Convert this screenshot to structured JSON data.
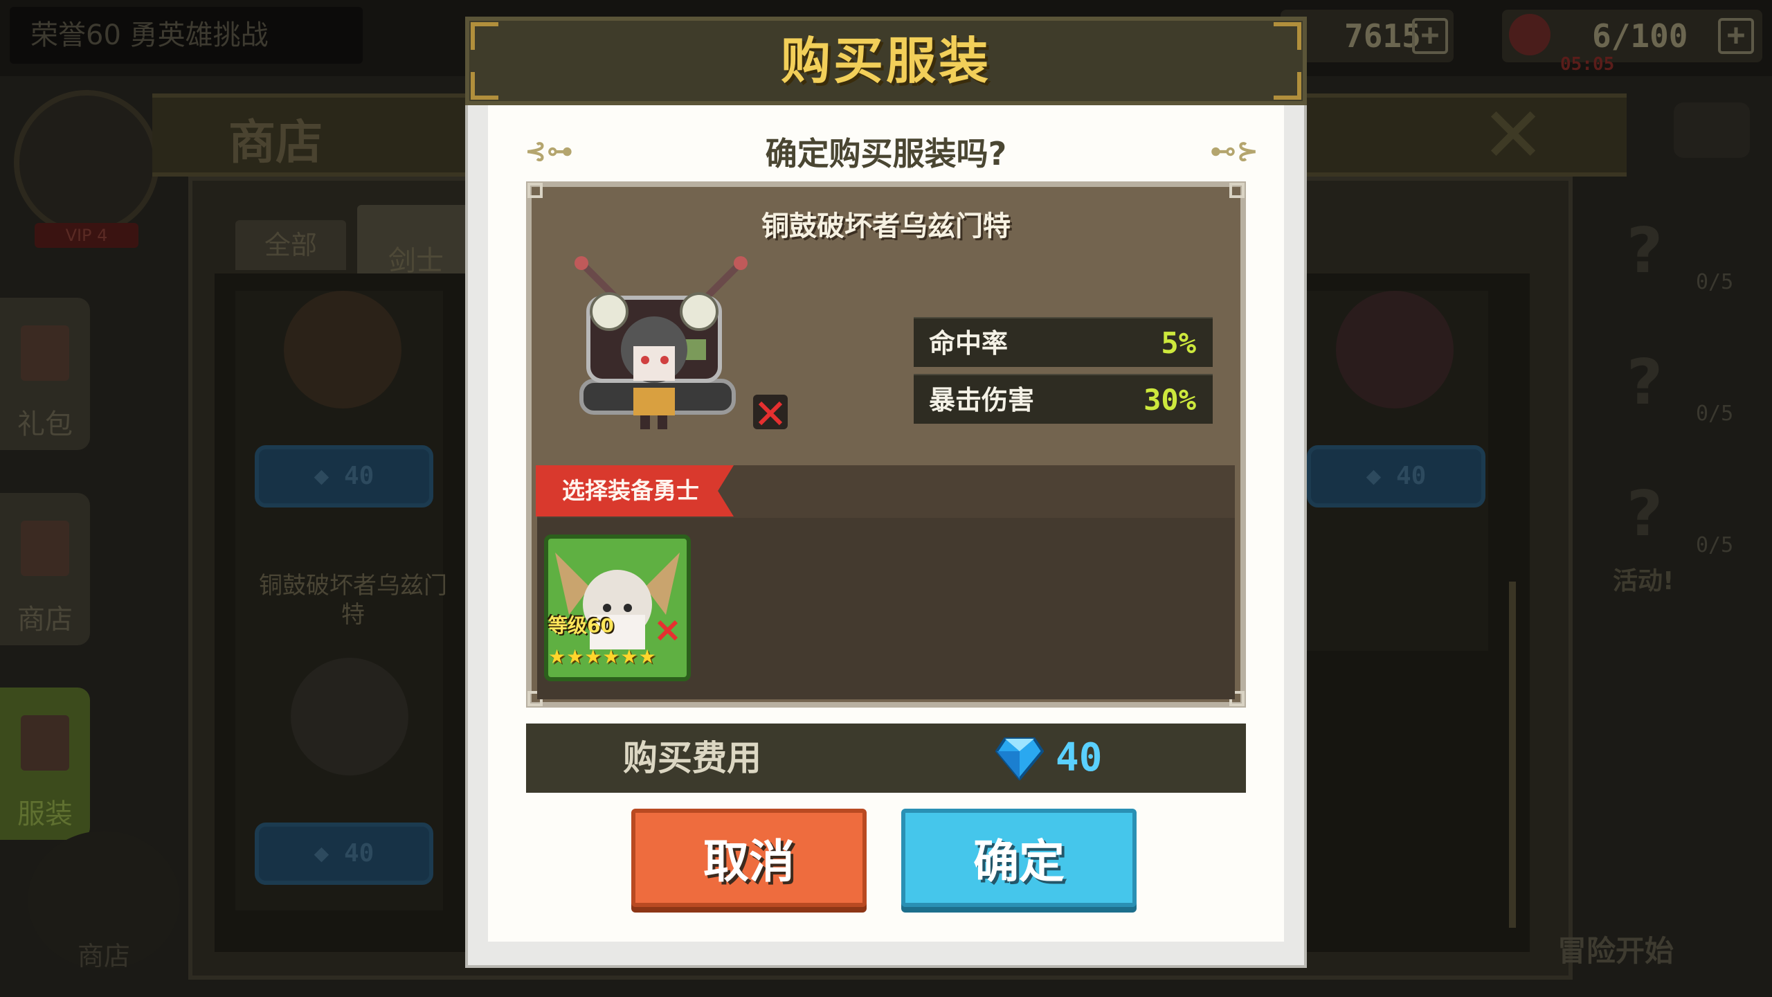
{
  "background": {
    "top_message": "荣誉60 勇英雄挑战",
    "gold": "7615",
    "stamina": "6/100",
    "stamina_timer": "05:05",
    "shop_title": "商店",
    "vip_label": "VIP 4",
    "side_tabs": [
      "礼包",
      "商店",
      "服装"
    ],
    "bottom_shop": "商店",
    "categories": [
      "全部",
      "剑士"
    ],
    "item_name_bg": "铜鼓破坏者乌兹门特",
    "gem_prices": [
      "40",
      "40",
      "40"
    ],
    "right_counts": [
      "0/5",
      "0/5",
      "0/5"
    ],
    "right_event": "活动!",
    "adventure_start": "冒险开始"
  },
  "modal": {
    "title": "购买服装",
    "question": "确定购买服装吗?",
    "item_name": "铜鼓破坏者乌兹门特",
    "stats": [
      {
        "label": "命中率",
        "value": "5%"
      },
      {
        "label": "暴击伤害",
        "value": "30%"
      }
    ],
    "select_hero_label": "选择装备勇士",
    "hero": {
      "level": "等级60",
      "stars": "★★★★★★"
    },
    "cost_label": "购买费用",
    "cost_value": "40",
    "cost_currency_icon": "diamond-icon",
    "cancel": "取消",
    "confirm": "确定"
  },
  "colors": {
    "title_gold": "#f2cf59",
    "stat_green": "#cde83d",
    "gem_blue": "#5ad0ff",
    "cancel_orange": "#ee6c3e",
    "confirm_blue": "#45c6eb",
    "ribbon_red": "#d9392d"
  }
}
